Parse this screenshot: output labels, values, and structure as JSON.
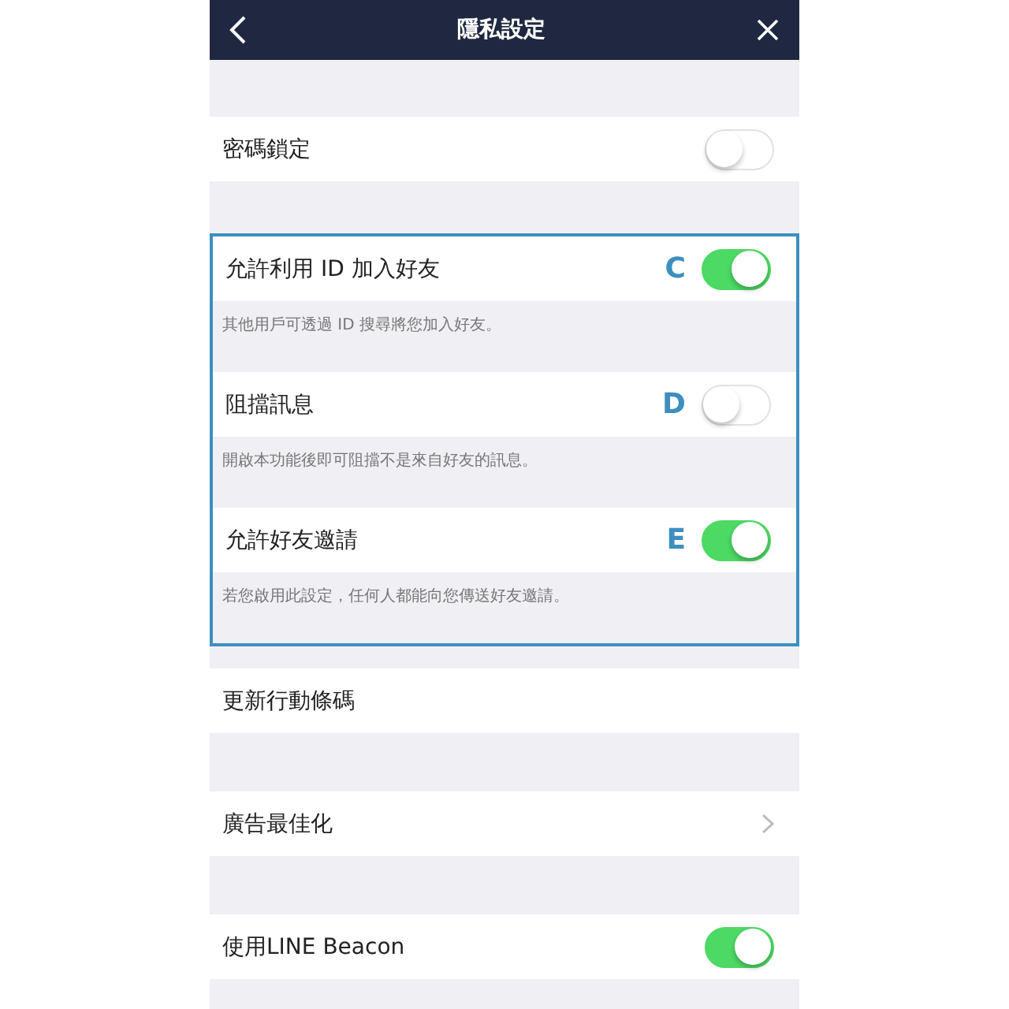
{
  "header": {
    "title": "隱私設定"
  },
  "groups": [
    {
      "highlighted": false,
      "items": [
        {
          "kind": "toggle",
          "label": "密碼鎖定",
          "on": false
        }
      ]
    },
    {
      "highlighted": true,
      "items": [
        {
          "kind": "toggle",
          "label": "允許利用 ID 加入好友",
          "annotation": "C",
          "on": true,
          "note": "其他用戶可透過 ID 搜尋將您加入好友。"
        },
        {
          "kind": "toggle",
          "label": "阻擋訊息",
          "annotation": "D",
          "on": false,
          "note": "開啟本功能後即可阻擋不是來自好友的訊息。"
        },
        {
          "kind": "toggle",
          "label": "允許好友邀請",
          "annotation": "E",
          "on": true,
          "note": "若您啟用此設定，任何人都能向您傳送好友邀請。"
        }
      ]
    },
    {
      "highlighted": false,
      "items": [
        {
          "kind": "plain",
          "label": "更新行動條碼"
        }
      ]
    },
    {
      "highlighted": false,
      "items": [
        {
          "kind": "link",
          "label": "廣告最佳化"
        }
      ]
    },
    {
      "highlighted": false,
      "items": [
        {
          "kind": "toggle",
          "label": "使用LINE Beacon",
          "on": true
        }
      ]
    }
  ]
}
